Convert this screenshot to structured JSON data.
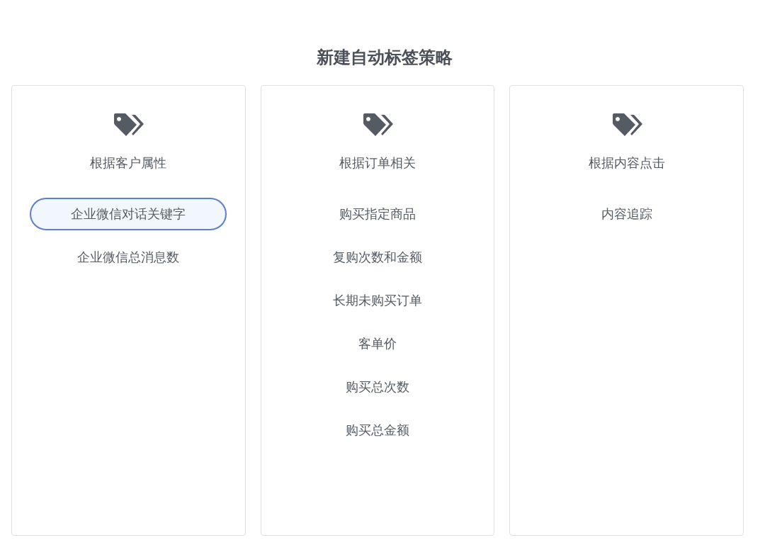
{
  "title": "新建自动标签策略",
  "categories": [
    {
      "name": "根据客户属性",
      "options": [
        {
          "label": "企业微信对话关键字",
          "selected": true
        },
        {
          "label": "企业微信总消息数",
          "selected": false
        }
      ]
    },
    {
      "name": "根据订单相关",
      "options": [
        {
          "label": "购买指定商品",
          "selected": false
        },
        {
          "label": "复购次数和金额",
          "selected": false
        },
        {
          "label": "长期未购买订单",
          "selected": false
        },
        {
          "label": "客单价",
          "selected": false
        },
        {
          "label": "购买总次数",
          "selected": false
        },
        {
          "label": "购买总金额",
          "selected": false
        }
      ]
    },
    {
      "name": "根据内容点击",
      "options": [
        {
          "label": "内容追踪",
          "selected": false
        }
      ]
    }
  ]
}
